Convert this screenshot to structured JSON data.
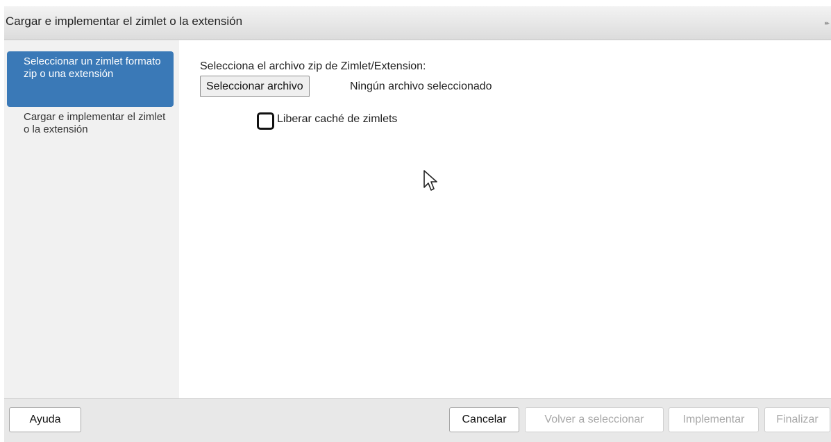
{
  "dialog": {
    "title": "Cargar e implementar el zimlet o la extensión",
    "expand_icon": "double-chevron-right-icon",
    "expand_glyph": "▸▸"
  },
  "sidebar": {
    "steps": [
      {
        "label": "Seleccionar un zimlet formato zip o una extensión",
        "active": true
      },
      {
        "label": "Cargar e implementar el zimlet o la extensión",
        "active": false
      }
    ],
    "active_color": "#3a79b7"
  },
  "main": {
    "file_label": "Selecciona el archivo zip de Zimlet/Extension:",
    "file_button": "Seleccionar archivo",
    "file_status": "Ningún archivo seleccionado",
    "flush_cache": {
      "label": "Liberar caché de zimlets",
      "checked": false
    }
  },
  "footer": {
    "help": "Ayuda",
    "cancel": "Cancelar",
    "back": "Volver a seleccionar",
    "deploy": "Implementar",
    "finish": "Finalizar"
  }
}
